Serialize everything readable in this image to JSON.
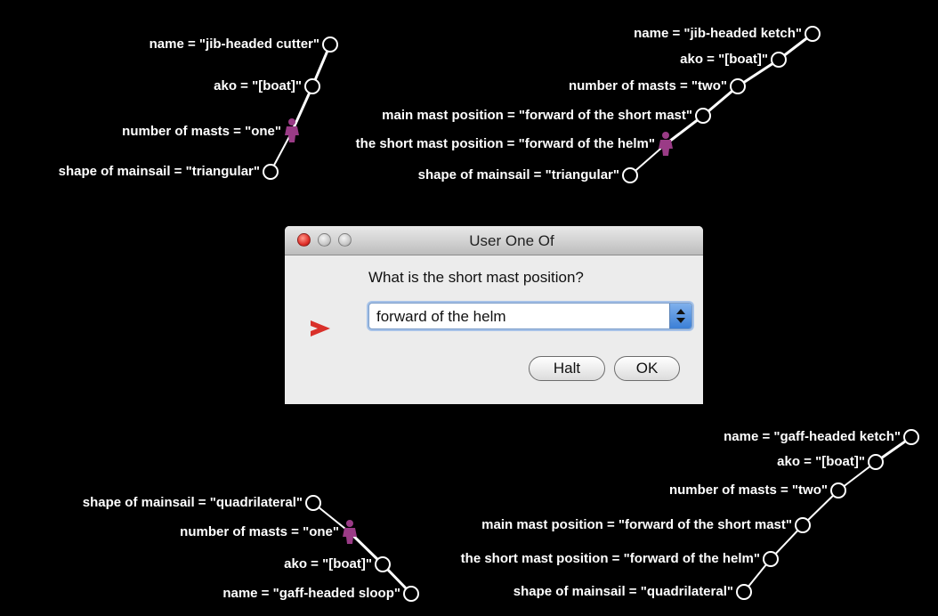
{
  "dialog": {
    "title": "User One Of",
    "prompt": "What is the short mast position?",
    "selected_value": "forward of the helm",
    "halt_label": "Halt",
    "ok_label": "OK"
  },
  "frames": [
    {
      "id": "jib-headed-cutter",
      "figure_on": "number of masts",
      "slots": [
        {
          "label": "name = \"jib-headed cutter\""
        },
        {
          "label": "ako = \"[boat]\""
        },
        {
          "label": "number of masts = \"one\""
        },
        {
          "label": "shape of mainsail = \"triangular\""
        }
      ]
    },
    {
      "id": "jib-headed-ketch",
      "figure_on": "the short mast position",
      "slots": [
        {
          "label": "name = \"jib-headed ketch\""
        },
        {
          "label": "ako = \"[boat]\""
        },
        {
          "label": "number of masts = \"two\""
        },
        {
          "label": "main mast position = \"forward of the short mast\""
        },
        {
          "label": "the short mast position = \"forward of the helm\""
        },
        {
          "label": "shape of mainsail = \"triangular\""
        }
      ]
    },
    {
      "id": "gaff-headed-sloop",
      "figure_on": "number of masts",
      "slots": [
        {
          "label": "shape of mainsail = \"quadrilateral\""
        },
        {
          "label": "number of masts = \"one\""
        },
        {
          "label": "ako = \"[boat]\""
        },
        {
          "label": "name = \"gaff-headed sloop\""
        }
      ]
    },
    {
      "id": "gaff-headed-ketch",
      "figure_on": "",
      "slots": [
        {
          "label": "name = \"gaff-headed ketch\""
        },
        {
          "label": "ako = \"[boat]\""
        },
        {
          "label": "number of masts = \"two\""
        },
        {
          "label": "main mast position = \"forward of the short mast\""
        },
        {
          "label": "the short mast position = \"forward of the helm\""
        },
        {
          "label": "shape of mainsail = \"quadrilateral\""
        }
      ]
    }
  ]
}
